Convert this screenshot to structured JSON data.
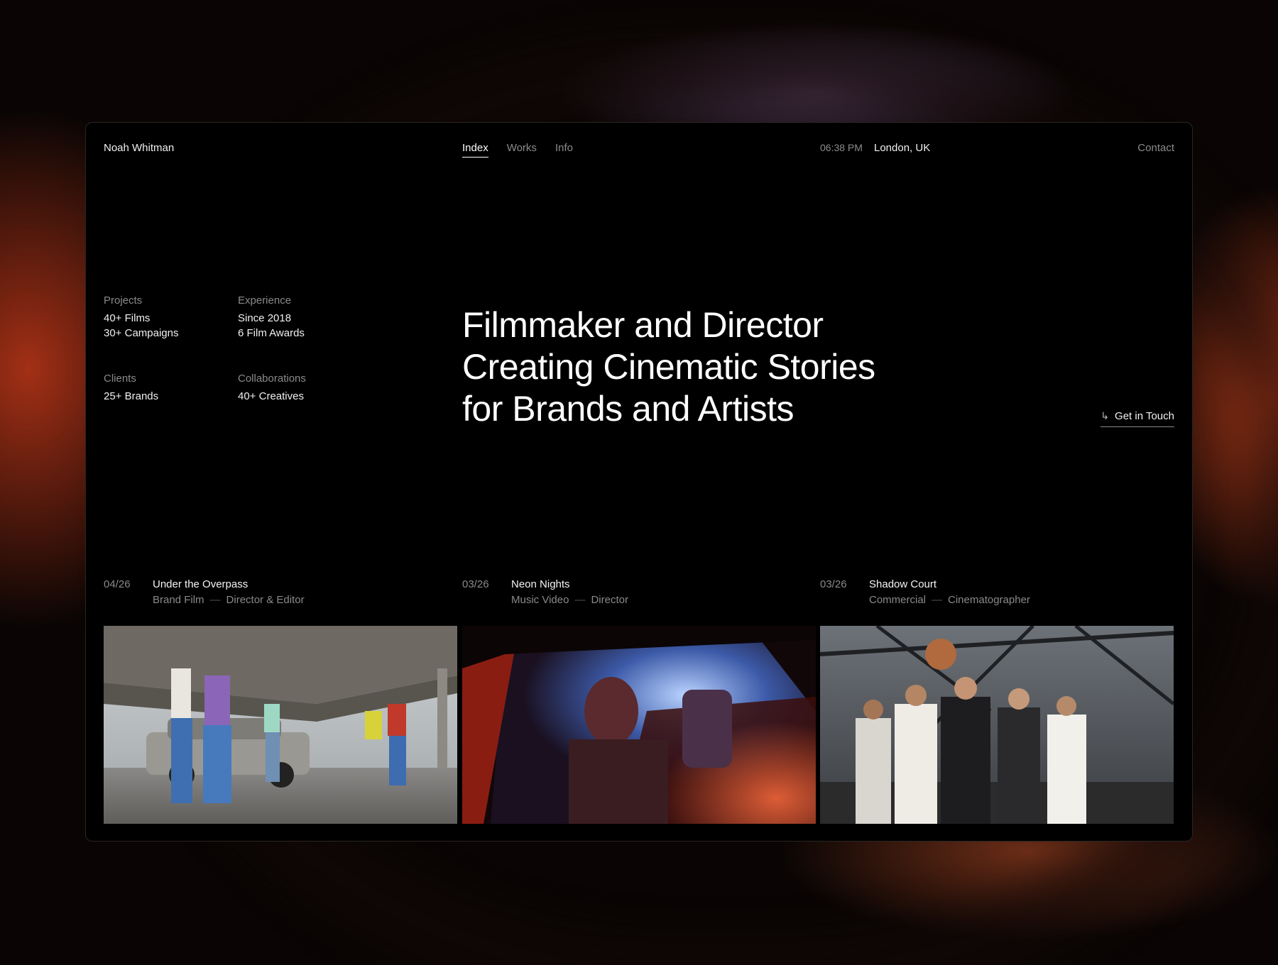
{
  "header": {
    "brand": "Noah Whitman",
    "nav": [
      {
        "label": "Index",
        "active": true
      },
      {
        "label": "Works",
        "active": false
      },
      {
        "label": "Info",
        "active": false
      }
    ],
    "time": "06:38 PM",
    "location": "London, UK",
    "contact": "Contact"
  },
  "stats": [
    {
      "label": "Projects",
      "lines": [
        "40+ Films",
        "30+ Campaigns"
      ]
    },
    {
      "label": "Experience",
      "lines": [
        "Since 2018",
        "6 Film Awards"
      ]
    },
    {
      "label": "Clients",
      "lines": [
        "25+ Brands"
      ]
    },
    {
      "label": "Collaborations",
      "lines": [
        "40+ Creatives"
      ]
    }
  ],
  "hero": {
    "lines": [
      "Filmmaker and Director",
      "Creating Cinematic Stories",
      "for Brands and Artists"
    ]
  },
  "cta": {
    "arrow": "↳",
    "label": "Get in Touch"
  },
  "projects": [
    {
      "date": "04/26",
      "title": "Under the Overpass",
      "category": "Brand Film",
      "separator": "—",
      "role": "Director & Editor",
      "image_icon": "overpass-photo"
    },
    {
      "date": "03/26",
      "title": "Neon Nights",
      "category": "Music Video",
      "separator": "—",
      "role": "Director",
      "image_icon": "neon-car-photo"
    },
    {
      "date": "03/26",
      "title": "Shadow Court",
      "category": "Commercial",
      "separator": "—",
      "role": "Cinematographer",
      "image_icon": "court-group-photo"
    }
  ],
  "colors": {
    "background": "#000000",
    "text": "#ffffff",
    "muted": "#8a8a8a",
    "accent_red": "#c0392b"
  }
}
